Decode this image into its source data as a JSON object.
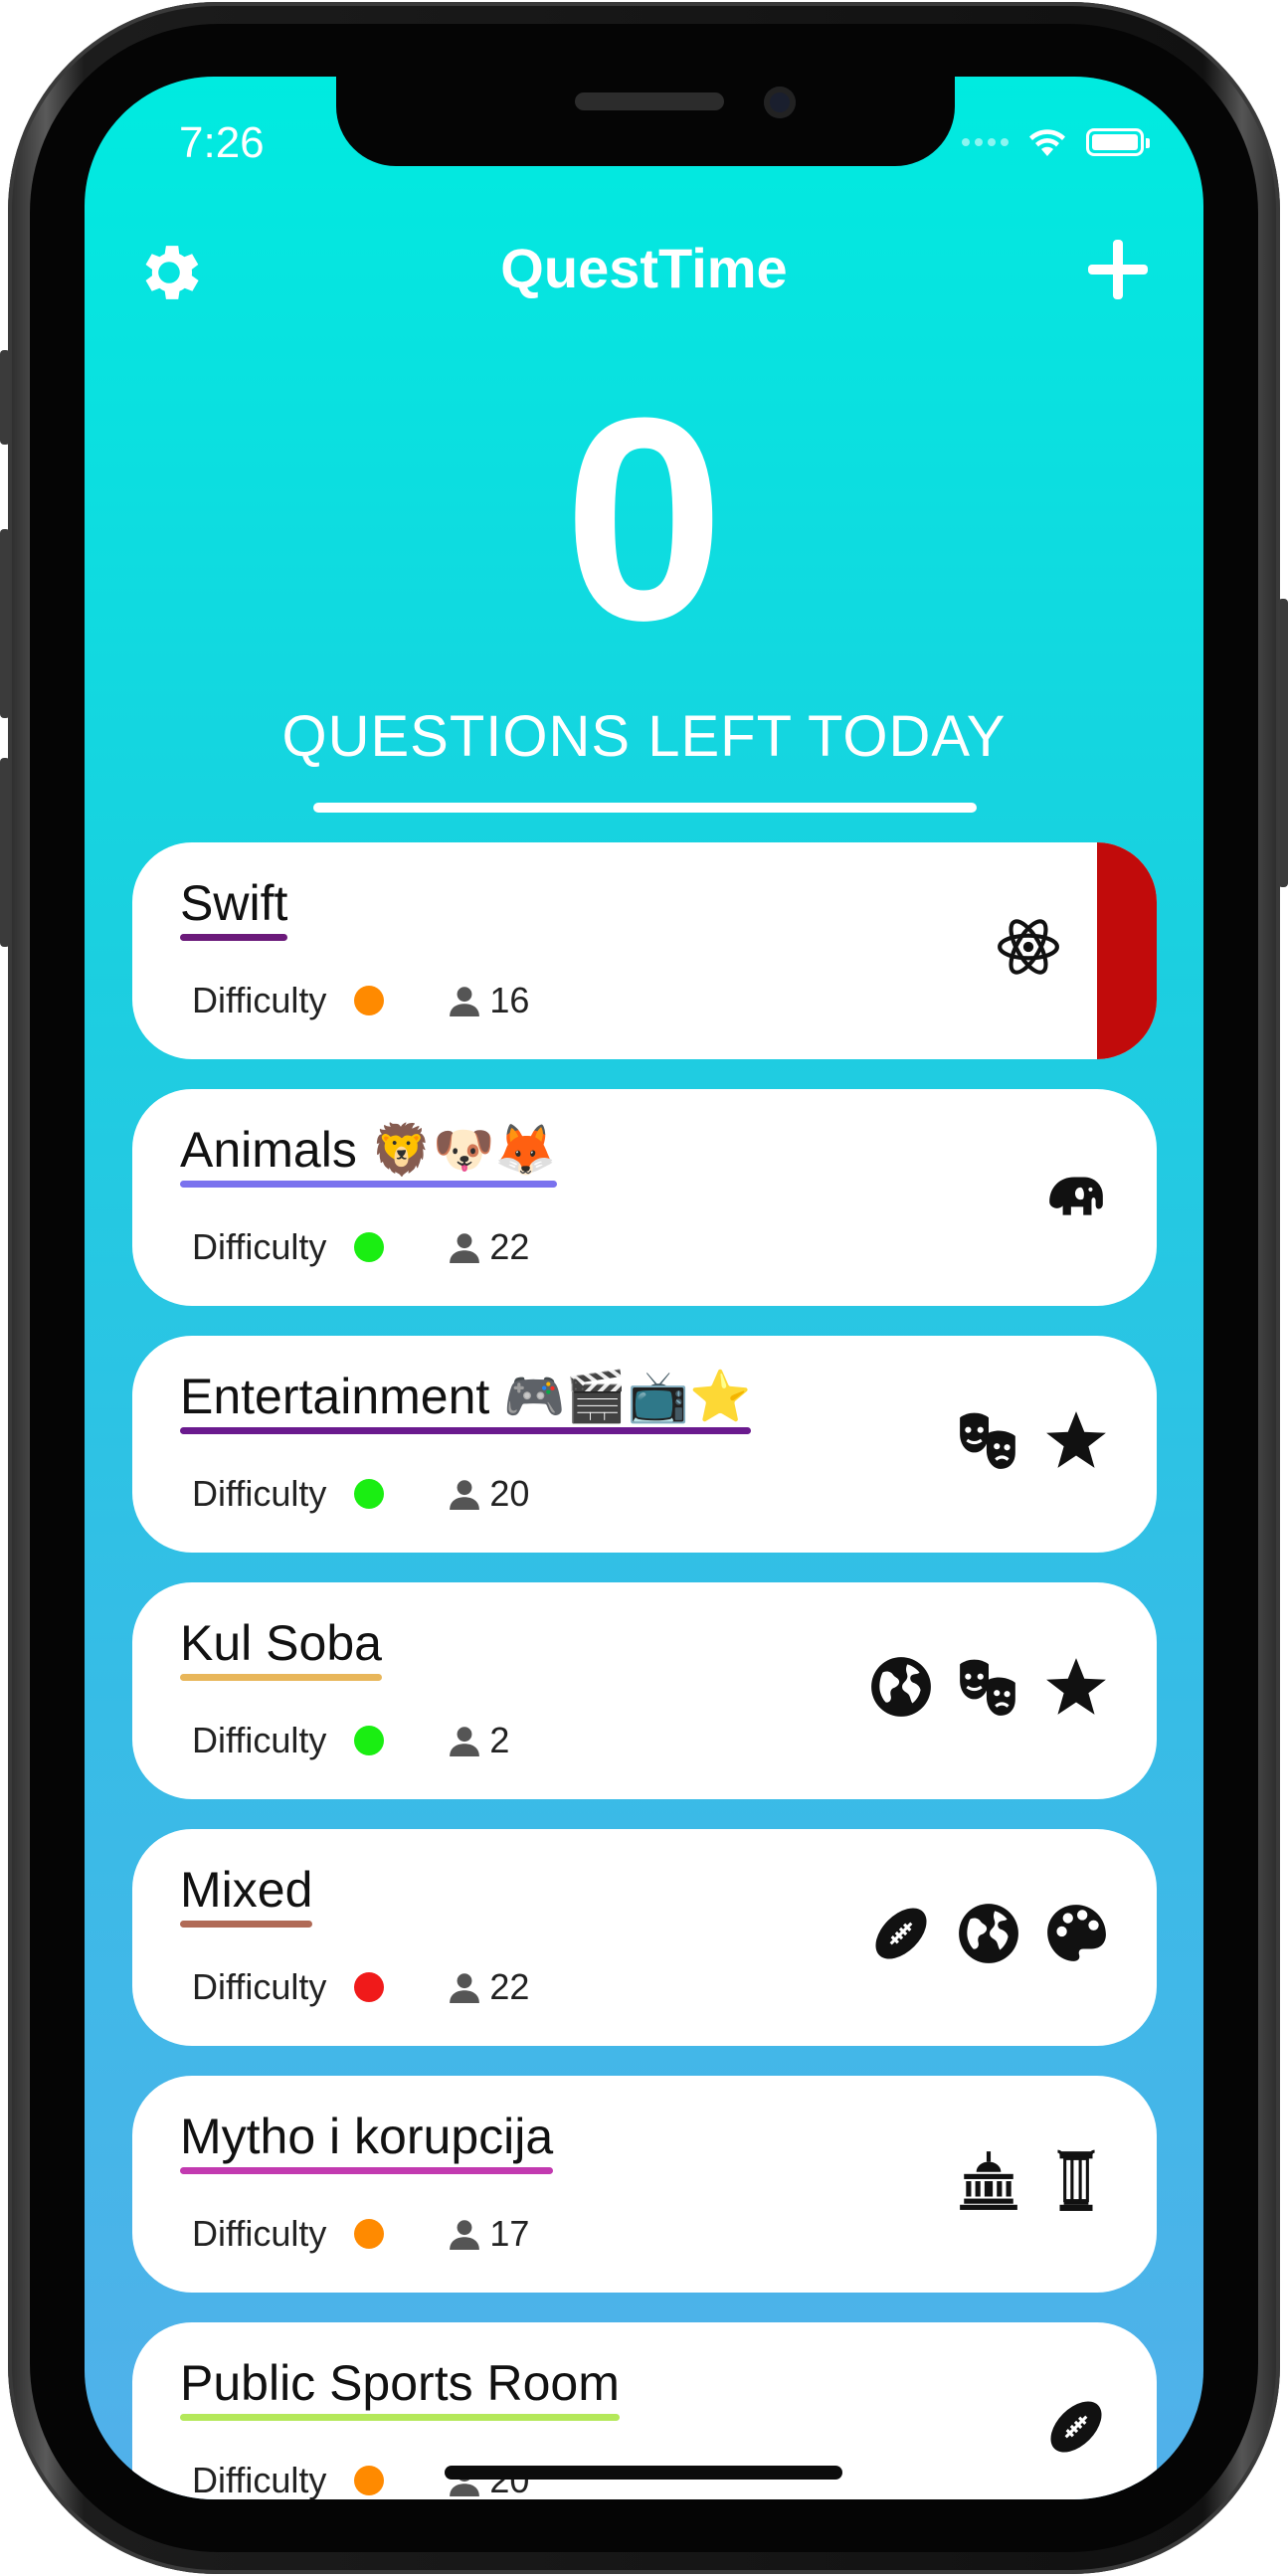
{
  "status": {
    "time": "7:26"
  },
  "header": {
    "title": "QuestTime"
  },
  "counter": {
    "value": "0",
    "label": "QUESTIONS LEFT TODAY"
  },
  "quizzes": [
    {
      "title": "Swift",
      "difficulty_label": "Difficulty",
      "difficulty_color": "#ff8a00",
      "players": "16",
      "underline_color": "#6b1a7a",
      "icons": [
        "atom-icon"
      ],
      "selected": true
    },
    {
      "title": "Animals 🦁🐶🦊",
      "difficulty_label": "Difficulty",
      "difficulty_color": "#1aee12",
      "players": "22",
      "underline_color": "#7a72ee",
      "icons": [
        "elephant-icon"
      ]
    },
    {
      "title": "Entertainment 🎮🎬📺⭐",
      "difficulty_label": "Difficulty",
      "difficulty_color": "#1aee12",
      "players": "20",
      "underline_color": "#6a1a8e",
      "icons": [
        "theater-masks-icon",
        "star-icon"
      ]
    },
    {
      "title": "Kul Soba",
      "difficulty_label": "Difficulty",
      "difficulty_color": "#1aee12",
      "players": "2",
      "underline_color": "#e8b65a",
      "icons": [
        "globe-icon",
        "theater-masks-icon",
        "star-icon"
      ]
    },
    {
      "title": "Mixed",
      "difficulty_label": "Difficulty",
      "difficulty_color": "#f01a1a",
      "players": "22",
      "underline_color": "#b06a56",
      "icons": [
        "football-icon",
        "globe-icon",
        "palette-icon"
      ]
    },
    {
      "title": "Mytho i korupcija",
      "difficulty_label": "Difficulty",
      "difficulty_color": "#ff8a00",
      "players": "17",
      "underline_color": "#c23ab0",
      "icons": [
        "landmark-icon",
        "column-icon"
      ]
    },
    {
      "title": "Public Sports Room",
      "difficulty_label": "Difficulty",
      "difficulty_color": "#ff8a00",
      "players": "20",
      "underline_color": "#b4e85a",
      "icons": [
        "football-icon"
      ]
    }
  ]
}
